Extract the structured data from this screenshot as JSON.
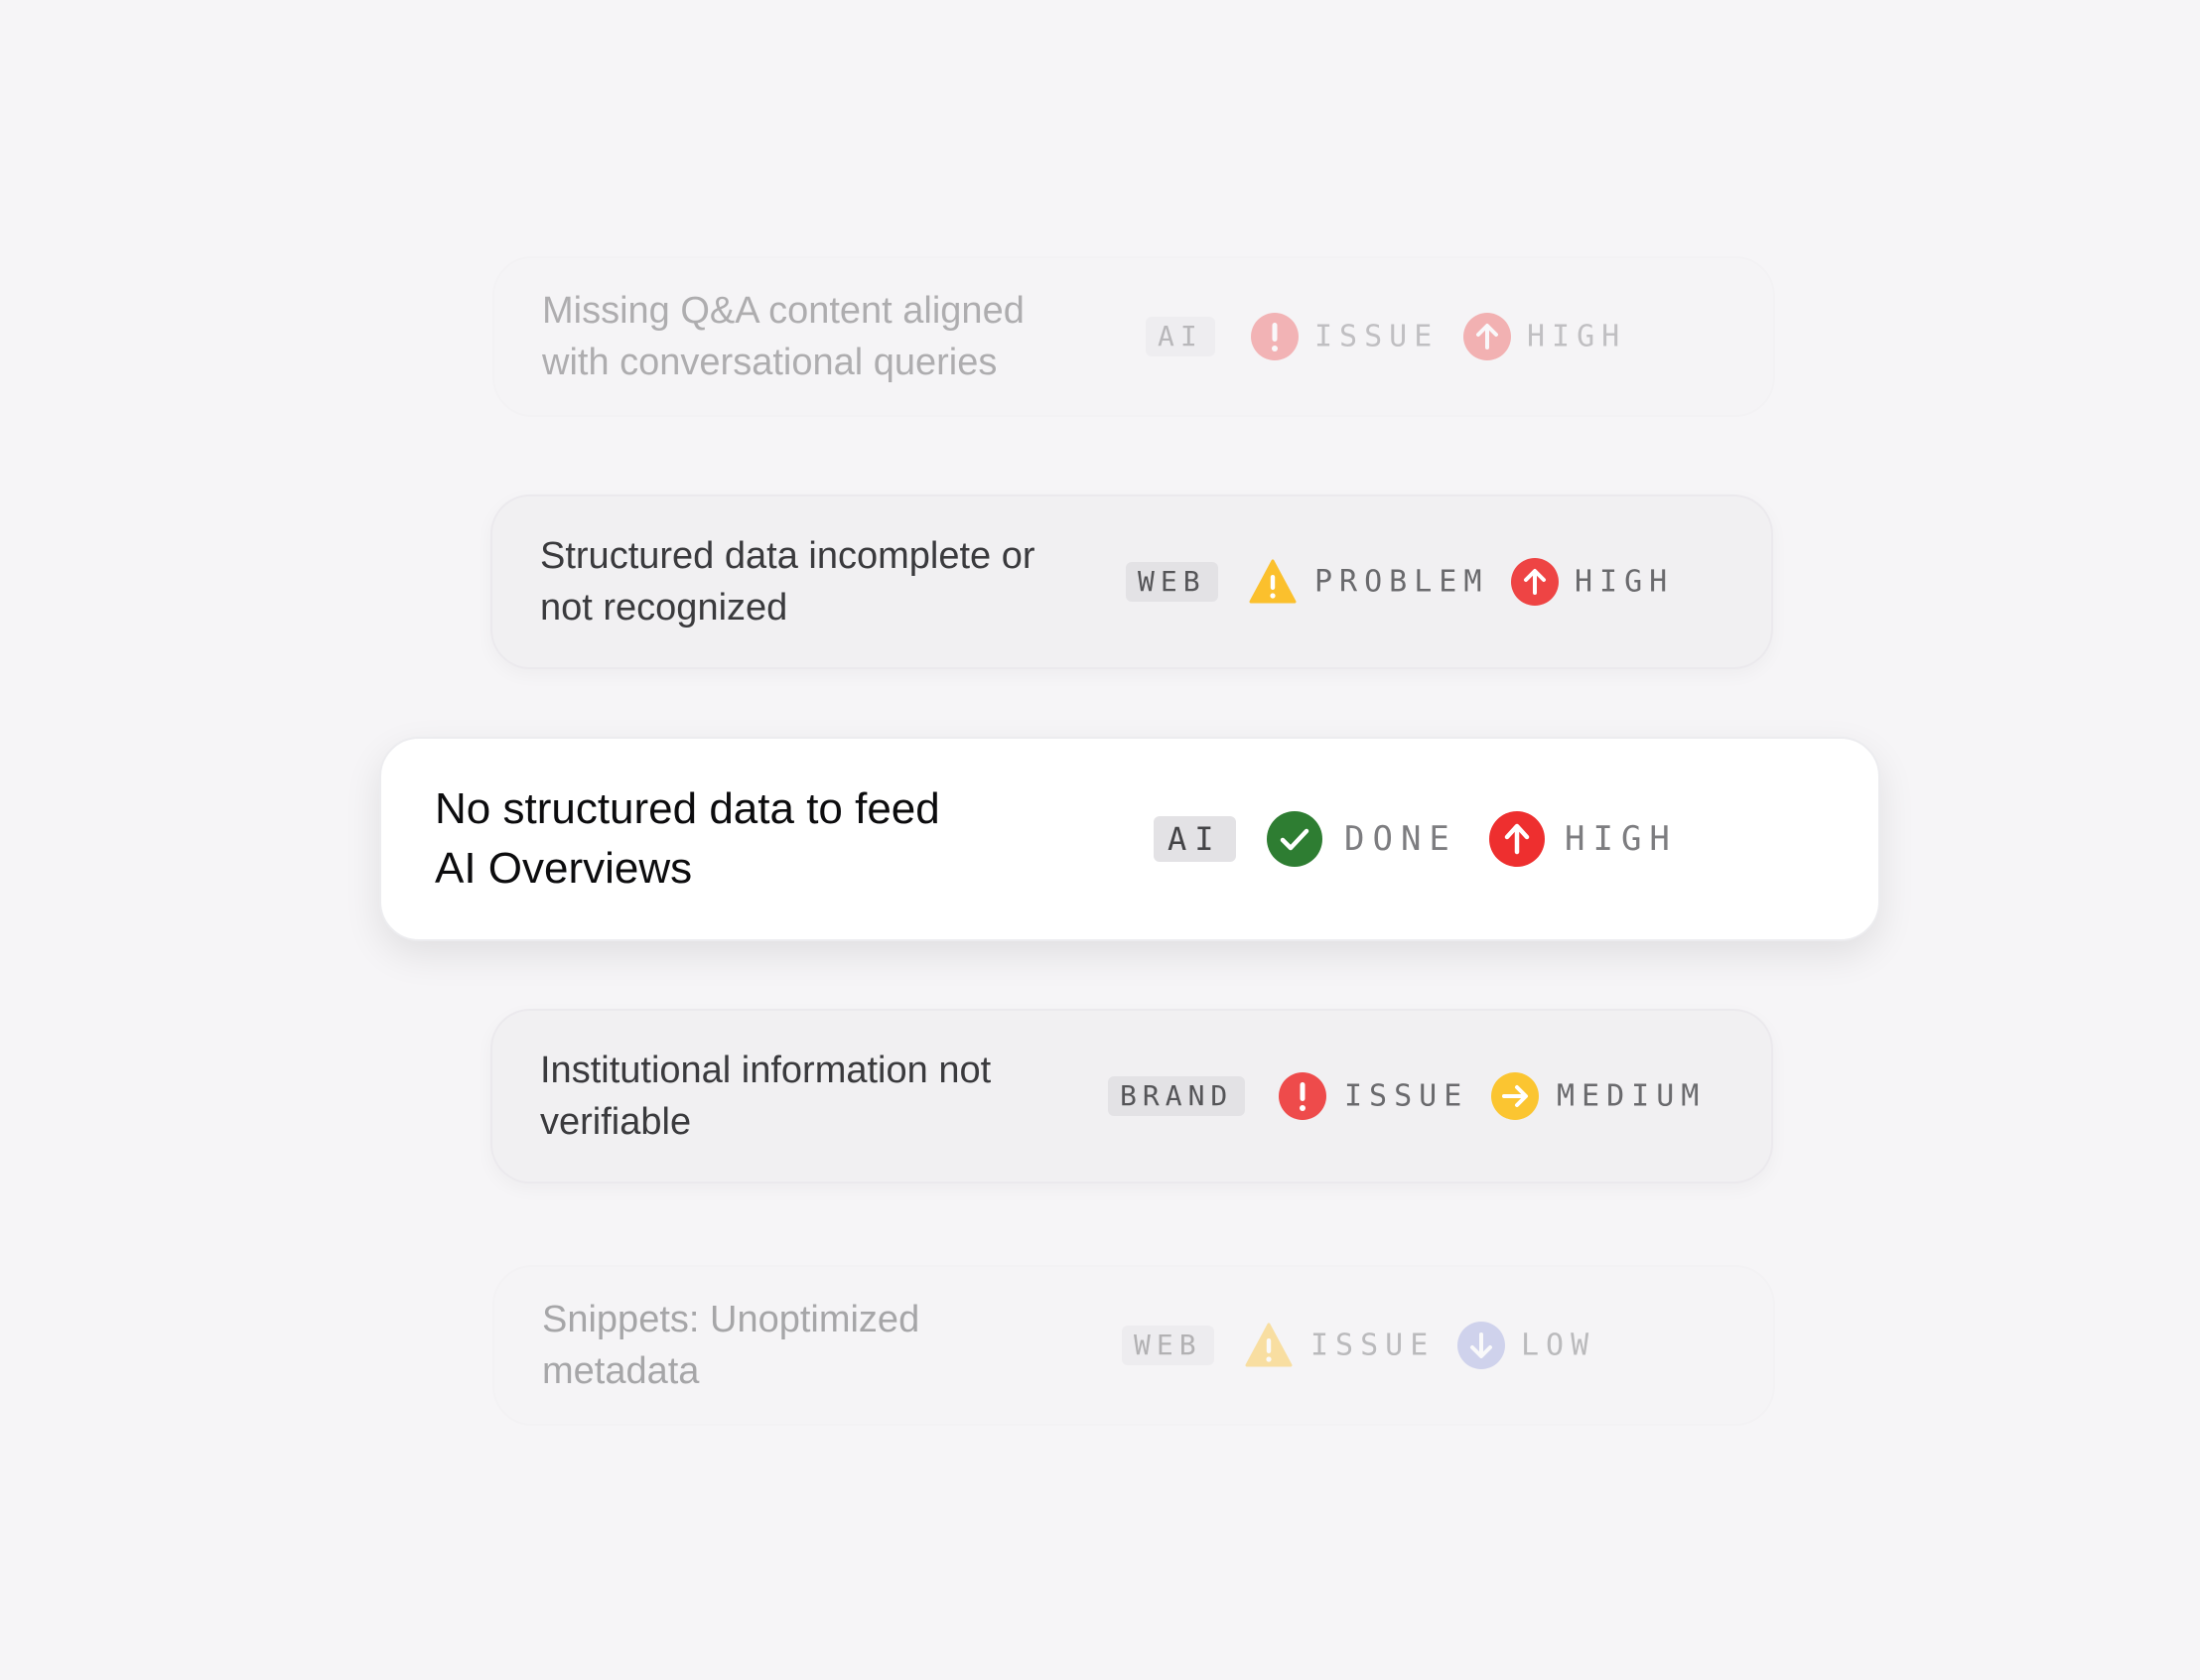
{
  "colors": {
    "background": "#f6f5f7",
    "card_bg": "#f1f0f2",
    "active_card_bg": "#ffffff",
    "issue_red": "#ee4b4b",
    "warning_yellow": "#fbc02d",
    "done_green": "#2e7d32",
    "priority_high": "#ee4444",
    "priority_medium": "#fbc531",
    "priority_low": "#9aa4dd"
  },
  "rows": [
    {
      "title": "Missing Q&A content aligned\nwith conversational queries",
      "tag": "AI",
      "status_label": "ISSUE",
      "status_icon": "exclamation-icon",
      "priority_label": "HIGH",
      "priority_icon": "arrow-up-icon"
    },
    {
      "title": "Structured data incomplete or\nnot recognized",
      "tag": "WEB",
      "status_label": "PROBLEM",
      "status_icon": "warning-triangle-icon",
      "priority_label": "HIGH",
      "priority_icon": "arrow-up-icon"
    },
    {
      "title": "No structured data to feed\nAI Overviews",
      "tag": "AI",
      "status_label": "DONE",
      "status_icon": "check-icon",
      "priority_label": "HIGH",
      "priority_icon": "arrow-up-icon"
    },
    {
      "title": "Institutional information not\nverifiable",
      "tag": "BRAND",
      "status_label": "ISSUE",
      "status_icon": "exclamation-icon",
      "priority_label": "MEDIUM",
      "priority_icon": "arrow-right-icon"
    },
    {
      "title": "Snippets: Unoptimized\nmetadata",
      "tag": "WEB",
      "status_label": "ISSUE",
      "status_icon": "warning-triangle-icon",
      "priority_label": "LOW",
      "priority_icon": "arrow-down-icon"
    }
  ]
}
